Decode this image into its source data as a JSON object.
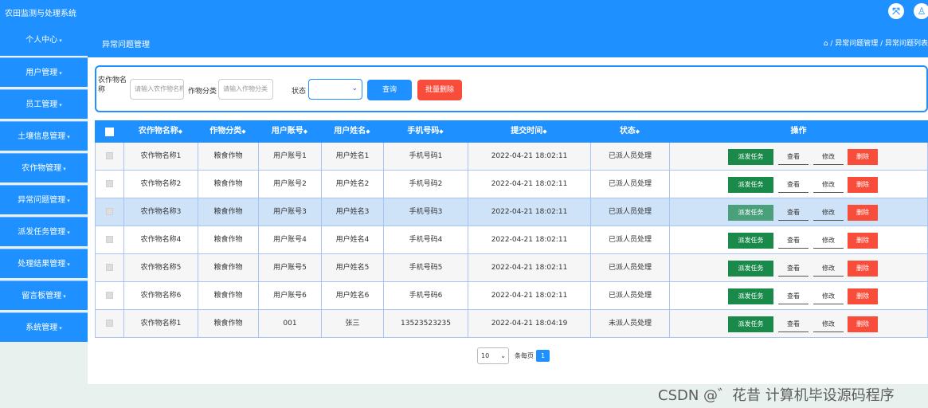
{
  "app": {
    "title": "农田监测与处理系统"
  },
  "colors": {
    "primary": "#1e90ff",
    "dispatch": "#1a8a4a",
    "delete": "#f94d3c",
    "highlight": "#cfe3f8"
  },
  "topbar_icons": [
    "fullscreen-icon",
    "user-icon"
  ],
  "sidebar": {
    "items": [
      {
        "label": "个人中心"
      },
      {
        "label": "用户管理"
      },
      {
        "label": "员工管理"
      },
      {
        "label": "土壤信息管理"
      },
      {
        "label": "农作物管理"
      },
      {
        "label": "异常问题管理"
      },
      {
        "label": "派发任务管理"
      },
      {
        "label": "处理结果管理"
      },
      {
        "label": "留言板管理"
      },
      {
        "label": "系统管理"
      }
    ]
  },
  "header": {
    "title": "异常问题管理",
    "breadcrumb": "⌂ / 异常问题管理 / 异常问题列表"
  },
  "search": {
    "crop_name_label": "农作物名称",
    "crop_name_placeholder": "请输入农作物名称",
    "category_label": "作物分类",
    "category_placeholder": "请输入作物分类",
    "status_label": "状态",
    "status_value": "",
    "query_button": "查询",
    "batch_delete_button": "批量删除"
  },
  "table": {
    "columns": [
      "农作物名称",
      "作物分类",
      "用户账号",
      "用户姓名",
      "手机号码",
      "提交时间",
      "状态",
      "操作"
    ],
    "sort_mark": "◆",
    "rows": [
      {
        "crop": "农作物名称1",
        "category": "粮食作物",
        "account": "用户账号1",
        "name": "用户姓名1",
        "phone": "手机号码1",
        "time": "2022-04-21 18:02:11",
        "status": "已派人员处理"
      },
      {
        "crop": "农作物名称2",
        "category": "粮食作物",
        "account": "用户账号2",
        "name": "用户姓名2",
        "phone": "手机号码2",
        "time": "2022-04-21 18:02:11",
        "status": "已派人员处理"
      },
      {
        "crop": "农作物名称3",
        "category": "粮食作物",
        "account": "用户账号3",
        "name": "用户姓名3",
        "phone": "手机号码3",
        "time": "2022-04-21 18:02:11",
        "status": "已派人员处理"
      },
      {
        "crop": "农作物名称4",
        "category": "粮食作物",
        "account": "用户账号4",
        "name": "用户姓名4",
        "phone": "手机号码4",
        "time": "2022-04-21 18:02:11",
        "status": "已派人员处理"
      },
      {
        "crop": "农作物名称5",
        "category": "粮食作物",
        "account": "用户账号5",
        "name": "用户姓名5",
        "phone": "手机号码5",
        "time": "2022-04-21 18:02:11",
        "status": "已派人员处理"
      },
      {
        "crop": "农作物名称6",
        "category": "粮食作物",
        "account": "用户账号6",
        "name": "用户姓名6",
        "phone": "手机号码6",
        "time": "2022-04-21 18:02:11",
        "status": "已派人员处理"
      },
      {
        "crop": "农作物名称1",
        "category": "粮食作物",
        "account": "001",
        "name": "张三",
        "phone": "13523523235",
        "time": "2022-04-21 18:04:19",
        "status": "未派人员处理"
      }
    ],
    "actions": {
      "dispatch": "派发任务",
      "view": "查看",
      "edit": "修改",
      "delete": "删除"
    },
    "highlighted_row": 3
  },
  "pagination": {
    "page_size": "10",
    "page_size_label": "条每页",
    "current_page": "1"
  },
  "watermark": "CSDN @゛花昔 计算机毕设源码程序"
}
